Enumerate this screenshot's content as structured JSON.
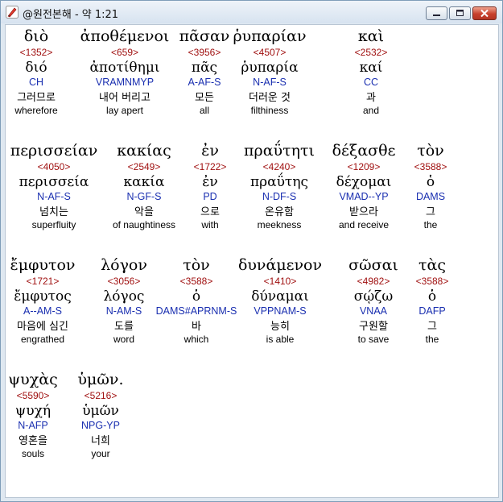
{
  "window": {
    "title": "@원전본해 - 약 1:21"
  },
  "colors": {
    "strong": "#a01010",
    "parse": "#1a2fb0"
  },
  "icons": {
    "app": "app-pen-icon",
    "minimize": "minimize-icon",
    "maximize": "maximize-icon",
    "close": "close-icon"
  },
  "words": [
    {
      "greek": "διὸ",
      "strong": "<1352>",
      "lemma": "διό",
      "parse": "CH",
      "korean": "그러므로",
      "english": "wherefore"
    },
    {
      "greek": "ἀποθέμενοι",
      "strong": "<659>",
      "lemma": "ἀποτίθημι",
      "parse": "VRAMNMYP",
      "korean": "내어 버리고",
      "english": "lay apert"
    },
    {
      "greek": "πᾶσαν",
      "strong": "<3956>",
      "lemma": "πᾶς",
      "parse": "A-AF-S",
      "korean": "모든",
      "english": "all"
    },
    {
      "greek": "ῥυπαρίαν",
      "strong": "<4507>",
      "lemma": "ῥυπαρία",
      "parse": "N-AF-S",
      "korean": "더러운 것",
      "english": "filthiness"
    },
    {
      "greek": "καὶ",
      "strong": "<2532>",
      "lemma": "καί",
      "parse": "CC",
      "korean": "과",
      "english": "and"
    },
    {
      "greek": "περισσείαν",
      "strong": "<4050>",
      "lemma": "περισσεία",
      "parse": "N-AF-S",
      "korean": "넘치는",
      "english": "superfluity"
    },
    {
      "greek": "κακίας",
      "strong": "<2549>",
      "lemma": "κακία",
      "parse": "N-GF-S",
      "korean": "악을",
      "english": "of naughtiness"
    },
    {
      "greek": "ἐν",
      "strong": "<1722>",
      "lemma": "ἐν",
      "parse": "PD",
      "korean": "으로",
      "english": "with"
    },
    {
      "greek": "πραΰτητι",
      "strong": "<4240>",
      "lemma": "πραΰτης",
      "parse": "N-DF-S",
      "korean": "온유함",
      "english": "meekness"
    },
    {
      "greek": "δέξασθε",
      "strong": "<1209>",
      "lemma": "δέχομαι",
      "parse": "VMAD--YP",
      "korean": "받으라",
      "english": "and receive"
    },
    {
      "greek": "τὸν",
      "strong": "<3588>",
      "lemma": "ὁ",
      "parse": "DAMS",
      "korean": "그",
      "english": "the"
    },
    {
      "greek": "ἔμφυτον",
      "strong": "<1721>",
      "lemma": "ἔμφυτος",
      "parse": "A--AM-S",
      "korean": "마음에 심긴",
      "english": "engrathed"
    },
    {
      "greek": "λόγον",
      "strong": "<3056>",
      "lemma": "λόγος",
      "parse": "N-AM-S",
      "korean": "도를",
      "english": "word"
    },
    {
      "greek": "τὸν",
      "strong": "<3588>",
      "lemma": "ὁ",
      "parse": "DAMS#APRNM-S",
      "korean": "바",
      "english": "which"
    },
    {
      "greek": "δυνάμενον",
      "strong": "<1410>",
      "lemma": "δύναμαι",
      "parse": "VPPNAM-S",
      "korean": "능히",
      "english": "is able"
    },
    {
      "greek": "σῶσαι",
      "strong": "<4982>",
      "lemma": "σῴζω",
      "parse": "VNAA",
      "korean": "구원할",
      "english": "to save"
    },
    {
      "greek": "τὰς",
      "strong": "<3588>",
      "lemma": "ὁ",
      "parse": "DAFP",
      "korean": "그",
      "english": "the"
    },
    {
      "greek": "ψυχὰς",
      "strong": "<5590>",
      "lemma": "ψυχή",
      "parse": "N-AFP",
      "korean": "영혼을",
      "english": "souls"
    },
    {
      "greek": "ὑμῶν.",
      "strong": "<5216>",
      "lemma": "ὑμῶν",
      "parse": "NPG-YP",
      "korean": "너희",
      "english": "your"
    }
  ]
}
